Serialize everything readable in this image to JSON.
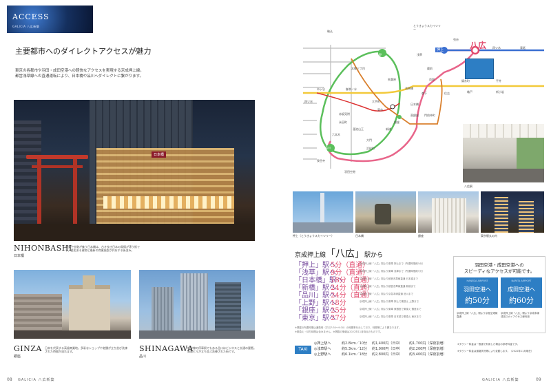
{
  "header": {
    "access_title": "ACCESS",
    "access_sub": "GALICIA 八広新築"
  },
  "left": {
    "heading": "主要都市へのダイレクトアクセスが魅力",
    "intro_line1": "東京の各都市や羽田・成田空港への軽快なアクセスを実現する京成押上線。",
    "intro_line2": "都営浅草線への直通運転により、日本橋や品川へダイレクトに繋がります。",
    "nihonbashi": {
      "en": "NIHONBASHI",
      "jp": "日本橋",
      "desc": "商業や金融が集う日本橋は、古き良き日本の風情が漂う街です。歴史ある建物と最新の商業施設が共存する街並み。"
    },
    "ginza": {
      "en": "GINZA",
      "jp": "銀座",
      "desc": "日本を代表する高級商業地。多彩なショップや老舗が立ち並び洗練された時間が流れます。"
    },
    "shinagawa": {
      "en": "SHINAGAWA",
      "jp": "品川",
      "desc": "新幹線の停車駅でもある品川はビジネスと交通の要衝。高層ビルが立ち並ぶ洗練された街です。"
    },
    "sign_text": "日本橋"
  },
  "map": {
    "yahiro": "八広",
    "oshiage": "押上",
    "stations": [
      "駒込",
      "とうきょうスカイツリー",
      "曳舟",
      "四ツ木",
      "青砥",
      "上野",
      "浅草",
      "本郷三丁目",
      "蔵前",
      "秋葉原",
      "両国",
      "浅草橋",
      "錦糸町",
      "亀戸",
      "平井",
      "新小岩",
      "市ヶ谷",
      "御茶ノ水",
      "森下",
      "住吉",
      "四ツ谷",
      "大手町",
      "日本橋",
      "東京",
      "東銀座",
      "銀座",
      "新橋",
      "赤坂見附",
      "永田町",
      "溜池山王",
      "六本木",
      "大門",
      "浜松町",
      "品川",
      "羽田空港",
      "門前仲町",
      "泉岳寺"
    ],
    "photo_caption": "八広駅"
  },
  "photos": {
    "cap1": "押上（とうきょうスカイツリー）",
    "cap2": "日本橋",
    "cap3": "銀座",
    "cap4": "東京駅丸の内"
  },
  "routes": {
    "title_pre": "京成押上線",
    "title_station": "「八広」",
    "title_post": "駅から",
    "rows": [
      {
        "name": "「押上」駅へ",
        "time": "5分（直通）",
        "note": "京成押上線「八広」駅より乗車 押上まで（所要時間約5分）"
      },
      {
        "name": "「浅草」駅へ",
        "time": "9分（直通）",
        "note": "京成押上線「八広」駅より乗車 浅草まで（所要時間約9分）"
      },
      {
        "name": "「日本橋」駅へ",
        "time": "18分（直通）",
        "note": "京成押上線「八広」駅より都営浅草線直通 日本橋まで"
      },
      {
        "name": "「新橋」駅へ",
        "time": "24分（直通）",
        "note": "京成押上線「八広」駅より都営浅草線直通 新橋まで"
      },
      {
        "name": "「品川」駅へ",
        "time": "24分（直通）",
        "note": "京成押上線「八広」駅より京急本線直通 品川まで"
      },
      {
        "name": "「上野」駅へ",
        "time": "18分",
        "note": "京成押上線「八広」駅より乗車 押上で乗換え 上野まで"
      },
      {
        "name": "「銀座」駅へ",
        "time": "25分",
        "note": "京成押上線「八広」駅より乗車 東銀座で乗換え 銀座まで"
      },
      {
        "name": "「東京」駅へ",
        "time": "27分",
        "note": "京成押上線「八広」駅より乗車 日本橋で乗換え 東京まで"
      }
    ],
    "footnote1": "※掲載の所要時間は通勤時（平日7:30〜9:30）の時間帯を示しており、時間帯により異なります。",
    "footnote2": "※乗換え・待ち時間は含みません。※掲載の情報は2022年11月時点のものです。"
  },
  "airport": {
    "heading1": "羽田空港・成田空港への",
    "heading2": "スピーディなアクセスが可能です。",
    "haneda_en": "HANEDA AIRPORT",
    "haneda_label": "羽田空港へ",
    "haneda_time": "約50分",
    "narita_en": "NARITA AIRPORT",
    "narita_label": "成田空港へ",
    "narita_time": "約60分",
    "haneda_note": "京成押上線「八広」駅より京急空港線直通",
    "narita_note": "京成押上線「八広」駅より京成本線 成田スカイアクセス線利用"
  },
  "taxi": {
    "label": "TAXI",
    "rows": [
      {
        "dest": "◎押上駅へ",
        "dist": "約2.8km／10分",
        "fare1": "約1,400円（日中）",
        "fare2": "約1,700円（深夜割増）"
      },
      {
        "dest": "◎浅草駅へ",
        "dist": "約5.3km／12分",
        "fare1": "約1,900円（日中）",
        "fare2": "約2,200円（深夜割増）"
      },
      {
        "dest": "◎上野駅へ",
        "dist": "約6.1km／18分",
        "fare1": "約2,800円（日中）",
        "fare2": "約3,400円（深夜割増）"
      }
    ],
    "note1": "※タクシー料金は一般道で利用した場合の参考料金です。",
    "note2": "※タクシー料金は道路状況等により変動します。（2022年11月現在）"
  },
  "footer": {
    "left_page": "08",
    "left_brand": "GALICIA 八広新築",
    "right_brand": "GALICIA 八広新築",
    "right_page": "09"
  },
  "colors": {
    "asakusa_line": "#e8658a",
    "keisei_line": "#3a6fd1",
    "yamanote": "#5bbf5b",
    "sobu": "#f2c93a",
    "accent_pink": "#e24b6e",
    "purple": "#7a4fa0",
    "airport_blue": "#2d7ec4"
  }
}
